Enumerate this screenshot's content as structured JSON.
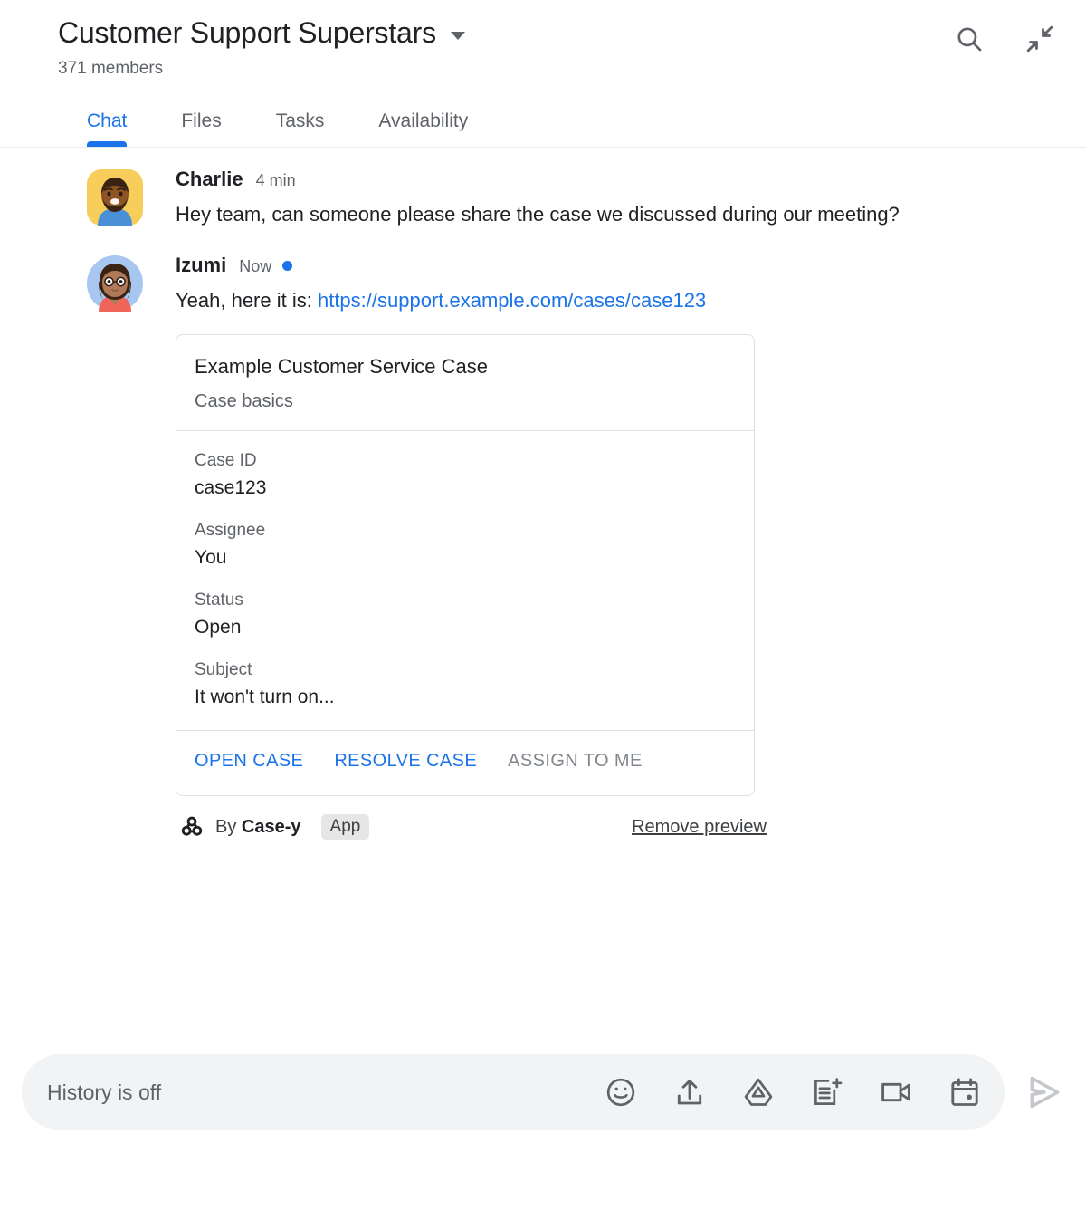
{
  "header": {
    "room_title": "Customer Support Superstars",
    "member_count": "371 members",
    "dropdown_icon": "chevron-down-icon",
    "actions": [
      {
        "name": "search-icon",
        "label": "Search"
      },
      {
        "name": "collapse-icon",
        "label": "Collapse"
      }
    ]
  },
  "tabs": [
    {
      "label": "Chat",
      "active": true
    },
    {
      "label": "Files",
      "active": false
    },
    {
      "label": "Tasks",
      "active": false
    },
    {
      "label": "Availability",
      "active": false
    }
  ],
  "messages": [
    {
      "sender": "Charlie",
      "timestamp": "4 min",
      "is_new": false,
      "text": "Hey team, can someone please share the case we discussed during our meeting?"
    },
    {
      "sender": "Izumi",
      "timestamp": "Now",
      "is_new": true,
      "text_prefix": "Yeah, here it is: ",
      "link_text": "https://support.example.com/cases/case123"
    }
  ],
  "card": {
    "title": "Example Customer Service Case",
    "subtitle": "Case basics",
    "fields": [
      {
        "label": "Case ID",
        "value": "case123"
      },
      {
        "label": "Assignee",
        "value": "You"
      },
      {
        "label": "Status",
        "value": "Open"
      },
      {
        "label": "Subject",
        "value": "It won't turn on..."
      }
    ],
    "actions": [
      {
        "label": "OPEN CASE",
        "enabled": true
      },
      {
        "label": "RESOLVE CASE",
        "enabled": true
      },
      {
        "label": "ASSIGN TO ME",
        "enabled": false
      }
    ]
  },
  "attribution": {
    "icon": "webhook-app-icon",
    "by_text": "By",
    "app_name": "Case-y",
    "chip_label": "App",
    "remove_preview_label": "Remove preview"
  },
  "compose": {
    "placeholder": "History is off",
    "icons": [
      {
        "name": "emoji-icon"
      },
      {
        "name": "upload-icon"
      },
      {
        "name": "google-drive-icon"
      },
      {
        "name": "new-document-icon"
      },
      {
        "name": "video-call-icon"
      },
      {
        "name": "calendar-icon"
      }
    ],
    "send_icon": "send-icon"
  },
  "colors": {
    "accent_blue": "#1a73e8",
    "text_primary": "#202124",
    "text_secondary": "#5f6368",
    "divider": "#e0e0e0",
    "compose_bg": "#f1f3f4",
    "disabled_text": "#80868b"
  }
}
